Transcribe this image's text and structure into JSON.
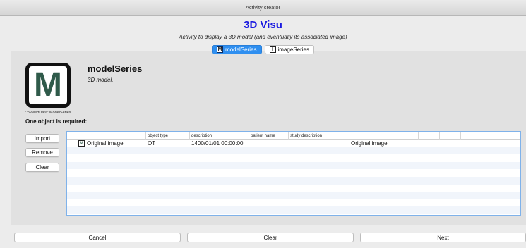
{
  "window": {
    "title": "Activity creator"
  },
  "header": {
    "title": "3D Visu",
    "subtitle": "Activity to display a 3D model (and eventually its associated image)"
  },
  "tabs": [
    {
      "label": "modelSeries",
      "icon": "M",
      "active": true
    },
    {
      "label": "imageSeries",
      "icon": "I",
      "active": false
    }
  ],
  "model": {
    "icon_letter": "M",
    "type_label": "::fwMedData::ModelSeries",
    "title": "modelSeries",
    "description": "3D model."
  },
  "required_text": "One object is required:",
  "side_buttons": {
    "import": "Import",
    "remove": "Remove",
    "clear": "Clear"
  },
  "table": {
    "columns": [
      "",
      "object type",
      "description",
      "patient name",
      "study description",
      "",
      "",
      "",
      "",
      ""
    ],
    "rows": [
      {
        "icon": "M",
        "name": "Original image",
        "object_type": "OT",
        "description": "1400/01/01 00:00:00",
        "patient_name": "",
        "study_description": "",
        "extra": "Original image"
      }
    ]
  },
  "footer": {
    "cancel": "Cancel",
    "clear": "Clear",
    "next": "Next"
  }
}
